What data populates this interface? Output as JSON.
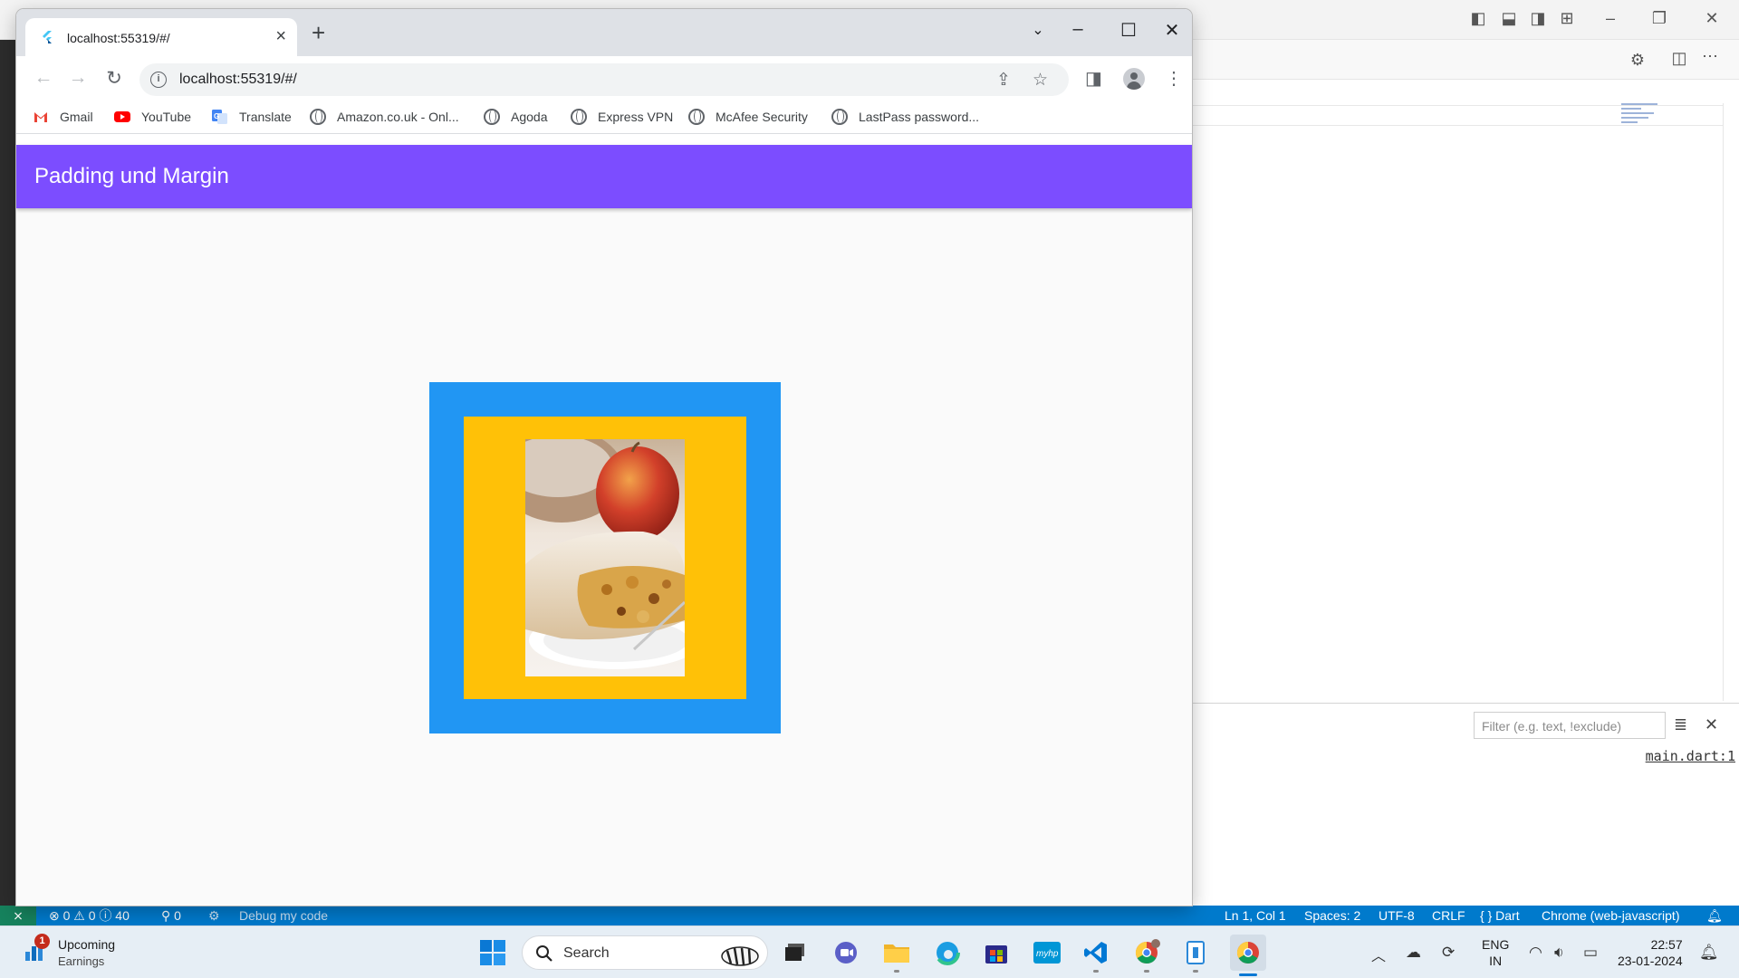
{
  "chrome": {
    "tab_title": "localhost:55319/#/",
    "url": "localhost:55319/#/",
    "bookmarks": [
      {
        "label": "Gmail",
        "icon": "gmail-icon"
      },
      {
        "label": "YouTube",
        "icon": "youtube-icon"
      },
      {
        "label": "Translate",
        "icon": "translate-icon"
      },
      {
        "label": "Amazon.co.uk - Onl...",
        "icon": "globe-icon"
      },
      {
        "label": "Agoda",
        "icon": "globe-icon"
      },
      {
        "label": "Express VPN",
        "icon": "globe-icon"
      },
      {
        "label": "McAfee Security",
        "icon": "globe-icon"
      },
      {
        "label": "LastPass password...",
        "icon": "globe-icon"
      }
    ]
  },
  "app": {
    "title": "Padding und Margin",
    "colors": {
      "appbar": "#7c4dff",
      "outer_box": "#2196f3",
      "inner_box": "#ffc107",
      "background": "#fafafa"
    }
  },
  "vscode": {
    "filter_placeholder": "Filter (e.g. text, !exclude)",
    "debug_link": "main.dart:1",
    "status": {
      "problems": "⊗ 0 ⚠ 0 ⓘ 40",
      "ports": "0",
      "debug": "Debug my code",
      "position": "Ln 1, Col 1",
      "spaces": "Spaces: 2",
      "encoding": "UTF-8",
      "eol": "CRLF",
      "language": "{ } Dart",
      "device": "Chrome (web-javascript)"
    }
  },
  "taskbar": {
    "weather_line1": "Upcoming",
    "weather_line2": "Earnings",
    "notification_count": "1",
    "search_label": "Search",
    "lang_line1": "ENG",
    "lang_line2": "IN",
    "time": "22:57",
    "date": "23-01-2024"
  }
}
